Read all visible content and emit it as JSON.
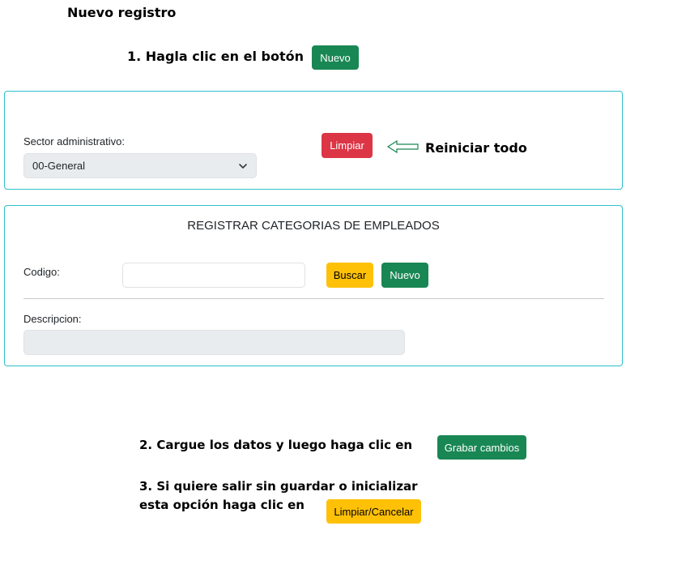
{
  "headings": {
    "title": "Nuevo registro",
    "step1": "1. Hagla clic en el botón",
    "reset_note": "Reiniciar todo",
    "step2": "2. Cargue los datos y luego haga clic en",
    "step3_line1": "3.  Si quiere salir sin guardar o inicializar",
    "step3_line2": "esta opción haga clic en"
  },
  "buttons": {
    "nuevo_top": "Nuevo",
    "limpiar": "Limpiar",
    "buscar": "Buscar",
    "nuevo_form": "Nuevo",
    "grabar": "Grabar cambios",
    "limpiar_cancelar": "Limpiar/Cancelar"
  },
  "filter_panel": {
    "sector_label": "Sector administrativo:",
    "sector_selected": "00-General"
  },
  "form_panel": {
    "title": "REGISTRAR CATEGORIAS DE EMPLEADOS",
    "codigo_label": "Codigo:",
    "codigo_value": "",
    "descripcion_label": "Descripcion:",
    "descripcion_value": ""
  },
  "colors": {
    "success": "#198754",
    "danger": "#dc3545",
    "warning": "#ffc107",
    "panel_border": "#2dc0cc",
    "arrow": "#198754"
  },
  "icons": {
    "select_caret": "chevron-down-icon",
    "pointer_arrow": "arrow-left-icon"
  }
}
